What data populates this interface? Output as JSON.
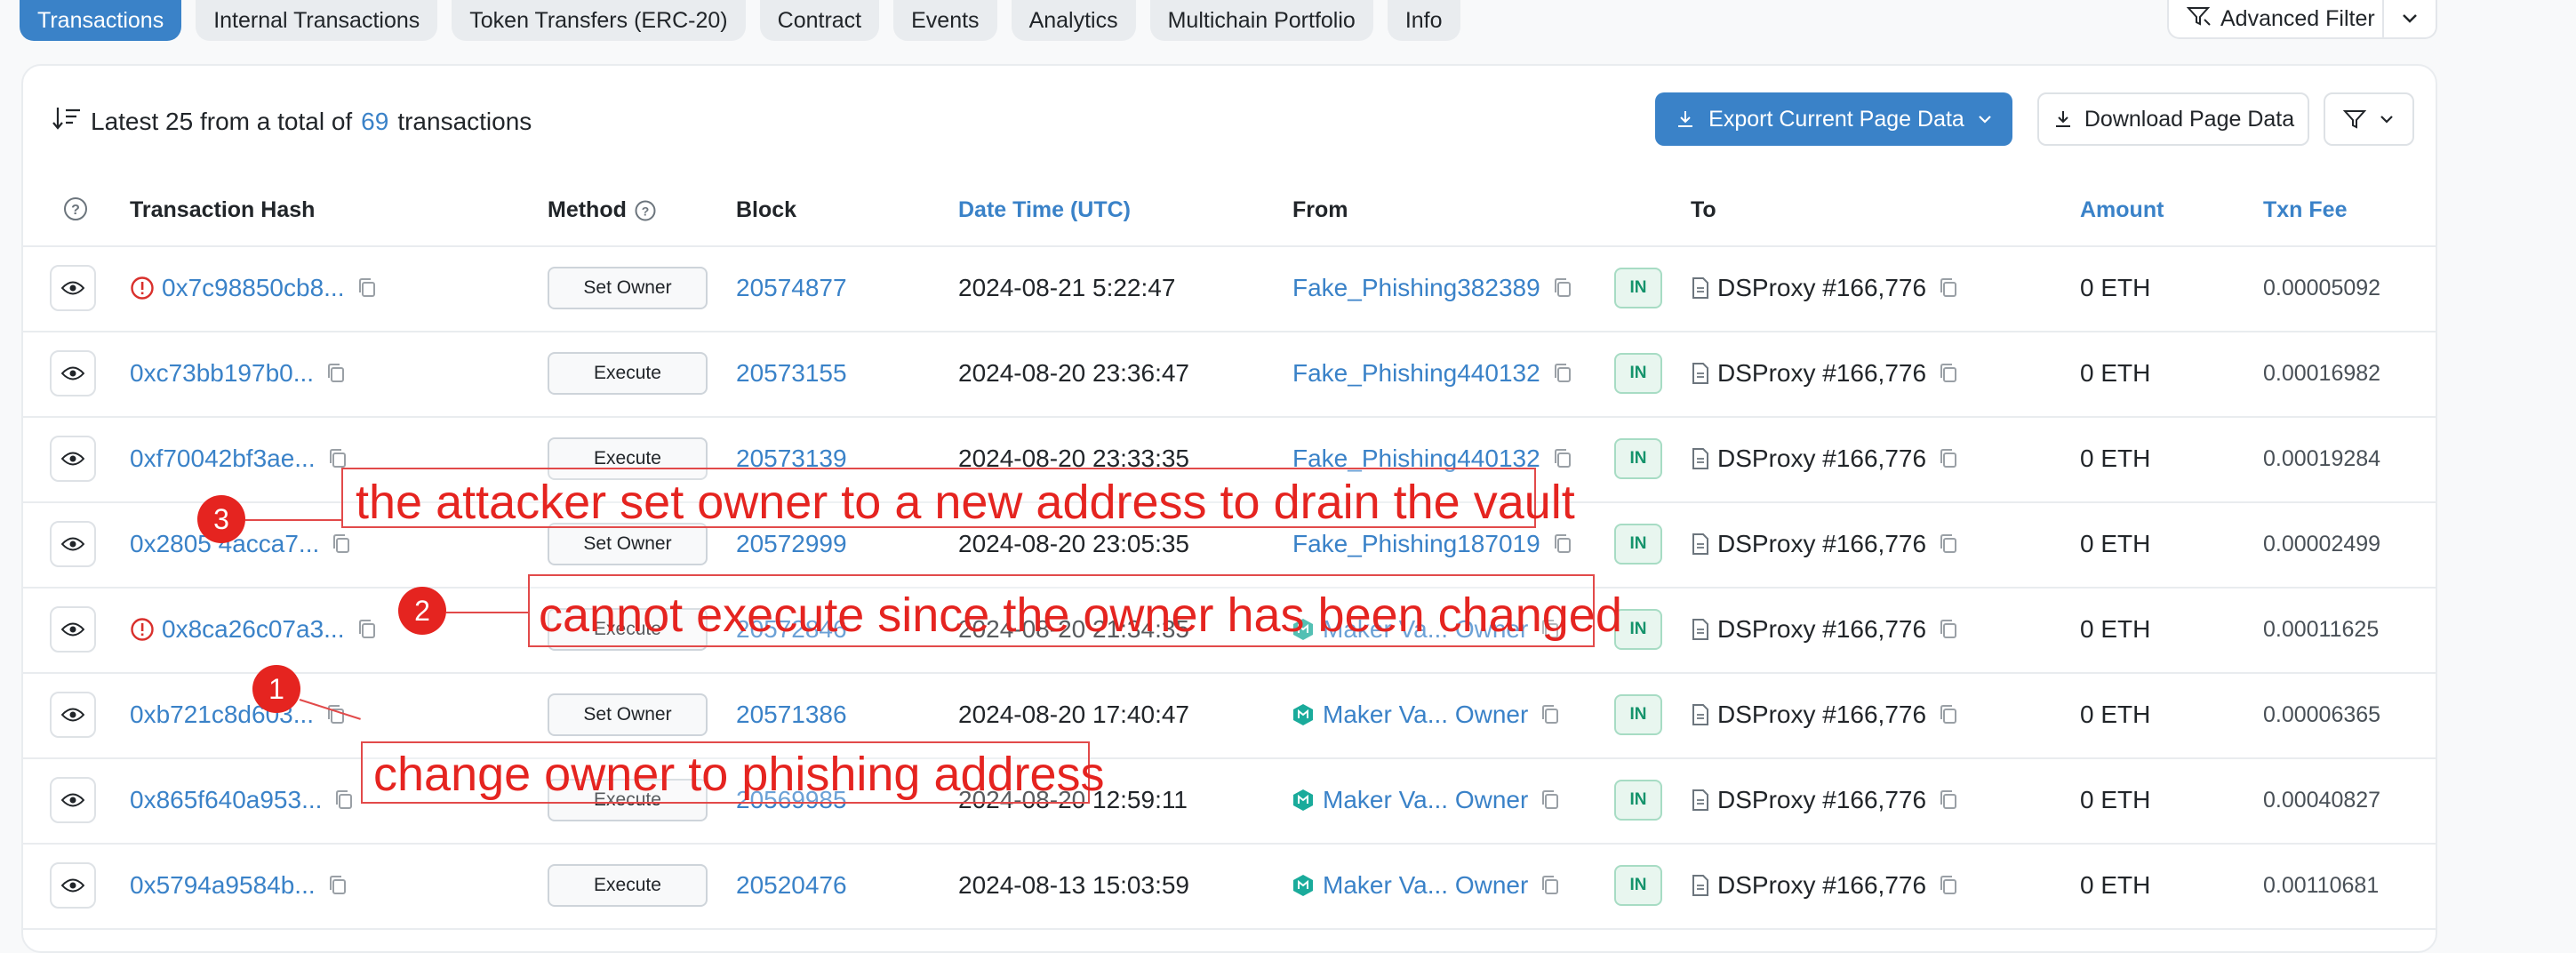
{
  "tabs": [
    {
      "label": "Transactions",
      "active": true
    },
    {
      "label": "Internal Transactions"
    },
    {
      "label": "Token Transfers (ERC-20)"
    },
    {
      "label": "Contract"
    },
    {
      "label": "Events"
    },
    {
      "label": "Analytics"
    },
    {
      "label": "Multichain Portfolio"
    },
    {
      "label": "Info"
    }
  ],
  "advanced_filter": "Advanced Filter",
  "summary": {
    "prefix": "Latest 25 from a total of",
    "count": "69",
    "suffix": "transactions"
  },
  "buttons": {
    "export": "Export Current Page Data",
    "download": "Download Page Data"
  },
  "columns": {
    "hash": "Transaction Hash",
    "method": "Method",
    "block": "Block",
    "datetime": "Date Time (UTC)",
    "from": "From",
    "to": "To",
    "amount": "Amount",
    "fee": "Txn Fee"
  },
  "rows": [
    {
      "error": true,
      "hash": "0x7c98850cb8...",
      "method": "Set Owner",
      "block": "20574877",
      "datetime": "2024-08-21 5:22:47",
      "from": "Fake_Phishing382389",
      "from_maker": false,
      "direction": "IN",
      "to": "DSProxy #166,776",
      "amount": "0 ETH",
      "fee": "0.00005092"
    },
    {
      "error": false,
      "hash": "0xc73bb197b0...",
      "method": "Execute",
      "block": "20573155",
      "datetime": "2024-08-20 23:36:47",
      "from": "Fake_Phishing440132",
      "from_maker": false,
      "direction": "IN",
      "to": "DSProxy #166,776",
      "amount": "0 ETH",
      "fee": "0.00016982"
    },
    {
      "error": false,
      "hash": "0xf70042bf3ae...",
      "method": "Execute",
      "block": "20573139",
      "datetime": "2024-08-20 23:33:35",
      "from": "Fake_Phishing440132",
      "from_maker": false,
      "direction": "IN",
      "to": "DSProxy #166,776",
      "amount": "0 ETH",
      "fee": "0.00019284"
    },
    {
      "error": false,
      "hash": "0x2805 4acca7...",
      "method": "Set Owner",
      "block": "20572999",
      "datetime": "2024-08-20 23:05:35",
      "from": "Fake_Phishing187019",
      "from_maker": false,
      "direction": "IN",
      "to": "DSProxy #166,776",
      "amount": "0 ETH",
      "fee": "0.00002499"
    },
    {
      "error": true,
      "hash": "0x8ca26c07a3...",
      "method": "Execute",
      "block": "20572846",
      "datetime": "2024-08-20 21:34:35",
      "from": "Maker Va... Owner",
      "from_maker": true,
      "direction": "IN",
      "to": "DSProxy #166,776",
      "amount": "0 ETH",
      "fee": "0.00011625"
    },
    {
      "error": false,
      "hash": "0xb721c8d603...",
      "method": "Set Owner",
      "block": "20571386",
      "datetime": "2024-08-20 17:40:47",
      "from": "Maker Va... Owner",
      "from_maker": true,
      "direction": "IN",
      "to": "DSProxy #166,776",
      "amount": "0 ETH",
      "fee": "0.00006365"
    },
    {
      "error": false,
      "hash": "0x865f640a953...",
      "method": "Execute",
      "block": "20569985",
      "datetime": "2024-08-20 12:59:11",
      "from": "Maker Va... Owner",
      "from_maker": true,
      "direction": "IN",
      "to": "DSProxy #166,776",
      "amount": "0 ETH",
      "fee": "0.00040827"
    },
    {
      "error": false,
      "hash": "0x5794a9584b...",
      "method": "Execute",
      "block": "20520476",
      "datetime": "2024-08-13 15:03:59",
      "from": "Maker Va... Owner",
      "from_maker": true,
      "direction": "IN",
      "to": "DSProxy #166,776",
      "amount": "0 ETH",
      "fee": "0.00110681"
    }
  ],
  "annotations": [
    {
      "number": "1",
      "text": "change owner to phishing address"
    },
    {
      "number": "2",
      "text": "cannot execute since the owner has been changed"
    },
    {
      "number": "3",
      "text": "the attacker set owner to a new address to drain the vault"
    }
  ],
  "colors": {
    "accent": "#3a82c8",
    "annotation": "#e52420",
    "in_badge": "#14936b"
  }
}
